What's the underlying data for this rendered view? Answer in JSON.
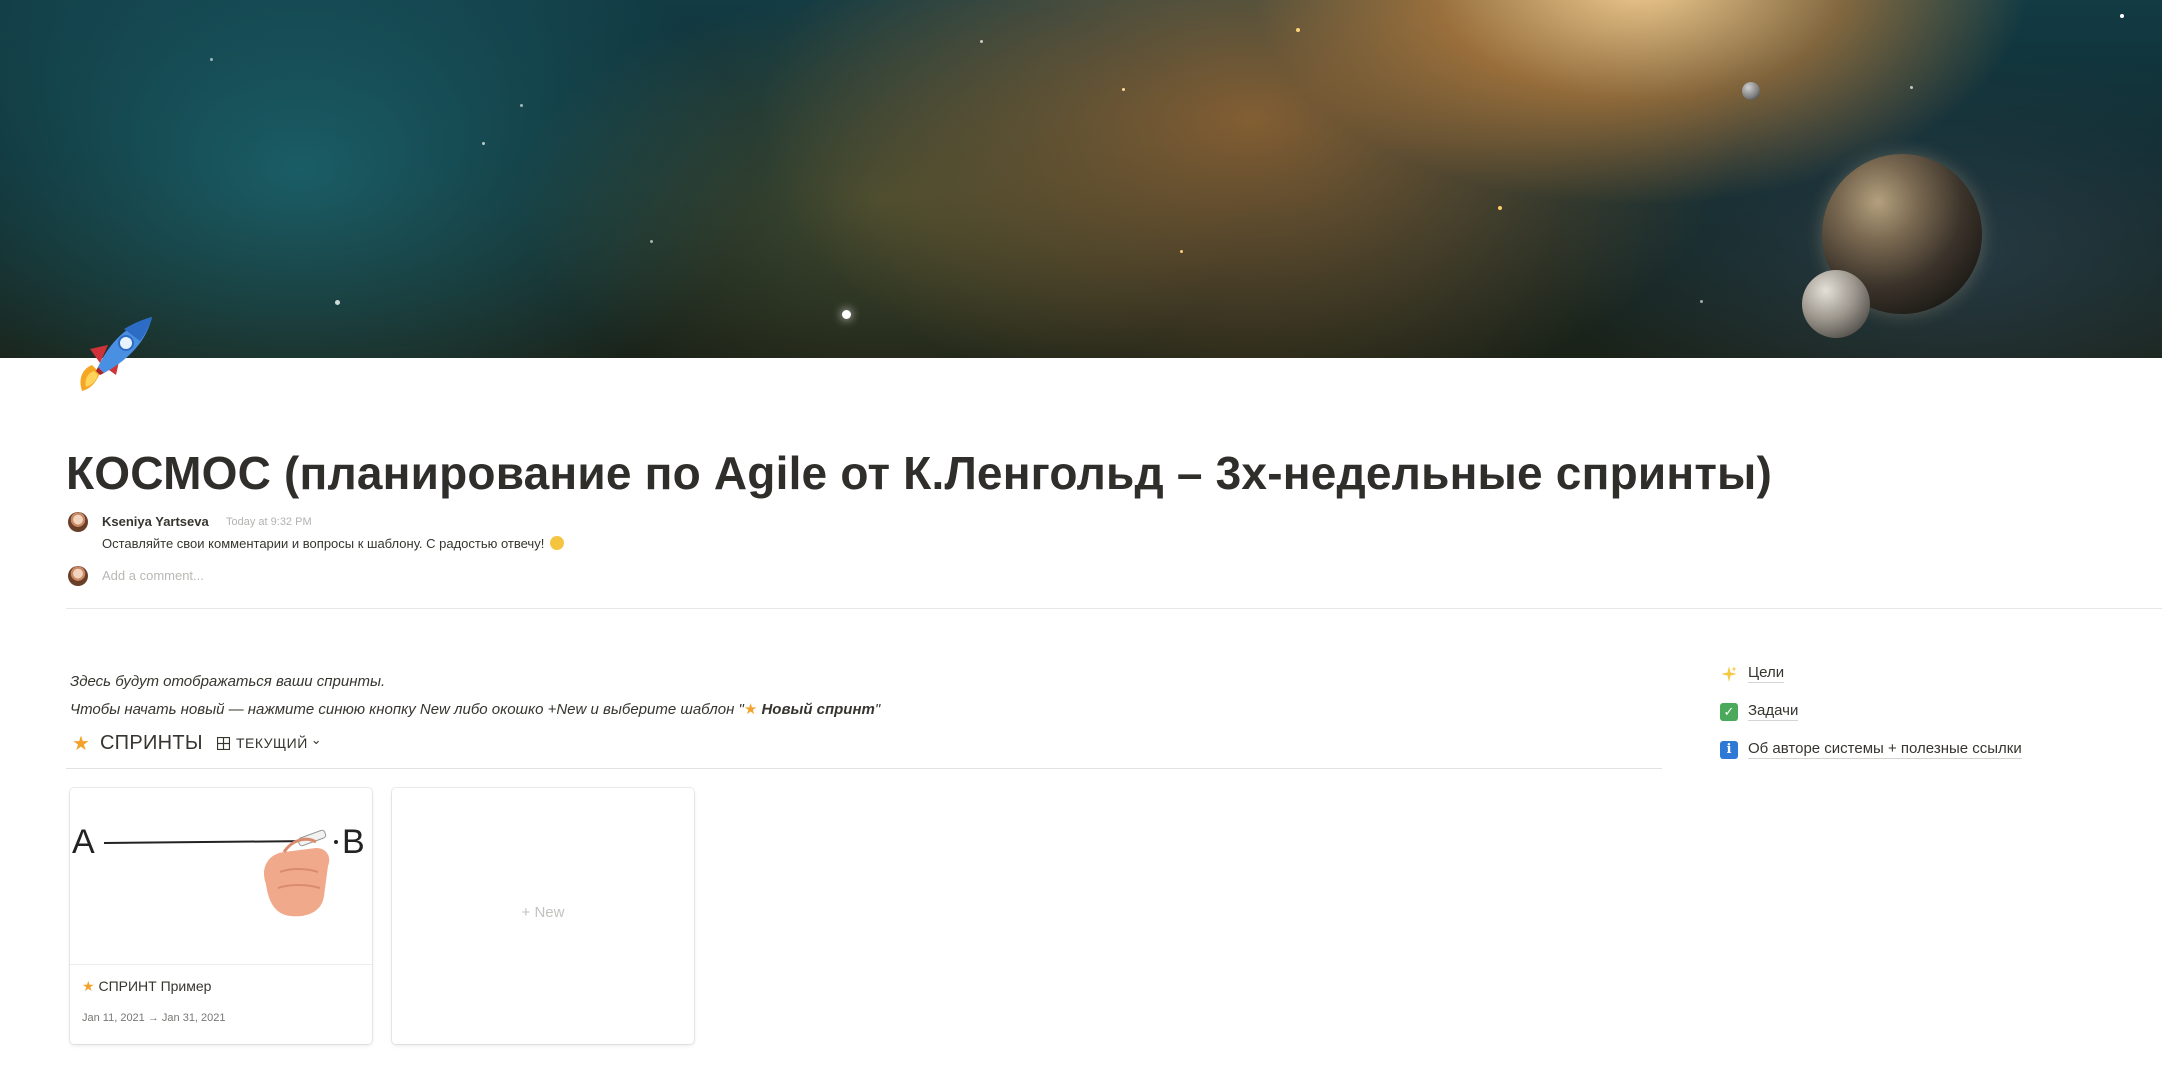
{
  "page": {
    "title": "КОСМОС (планирование по Agile от К.Ленгольд – 3х-недельные спринты)",
    "icon": "rocket-icon"
  },
  "comment": {
    "author": "Kseniya Yartseva",
    "time": "Today at 9:32 PM",
    "text": "Оставляйте свои комментарии и вопросы к шаблону. С радостью отвечу!",
    "emoji": "smiling-face-icon"
  },
  "add_comment": {
    "placeholder": "Add a comment..."
  },
  "intro": {
    "line1": "Здесь будут отображаться ваши спринты.",
    "line2_prefix": "Чтобы начать новый — нажмите синюю кнопку New либо окошко +New и выберите шаблон \"",
    "line2_star": "★",
    "line2_bold": " Новый спринт",
    "line2_suffix": "\""
  },
  "database": {
    "star": "★",
    "title": "СПРИНТЫ",
    "view_label": "ТЕКУЩИЙ",
    "view_chevron": "⌄"
  },
  "cards": [
    {
      "star": "★",
      "name": "СПРИНТ Пример",
      "dates": "Jan 11, 2021 → Jan 31, 2021",
      "cover_label_a": "A",
      "cover_label_b": "B"
    }
  ],
  "new_card": {
    "label": "+ New"
  },
  "links": [
    {
      "icon": "sparkles-icon",
      "label": "Цели",
      "icon_color": "#f7c843"
    },
    {
      "icon": "check-box-icon",
      "label": "Задачи",
      "icon_color": "#4aa95a",
      "glyph": "✓"
    },
    {
      "icon": "info-icon",
      "label": "Об авторе системы + полезные ссылки",
      "icon_color": "#2f79d6",
      "glyph": "i"
    }
  ],
  "colors": {
    "accent_star": "#f3a32b",
    "text": "#37352f"
  }
}
